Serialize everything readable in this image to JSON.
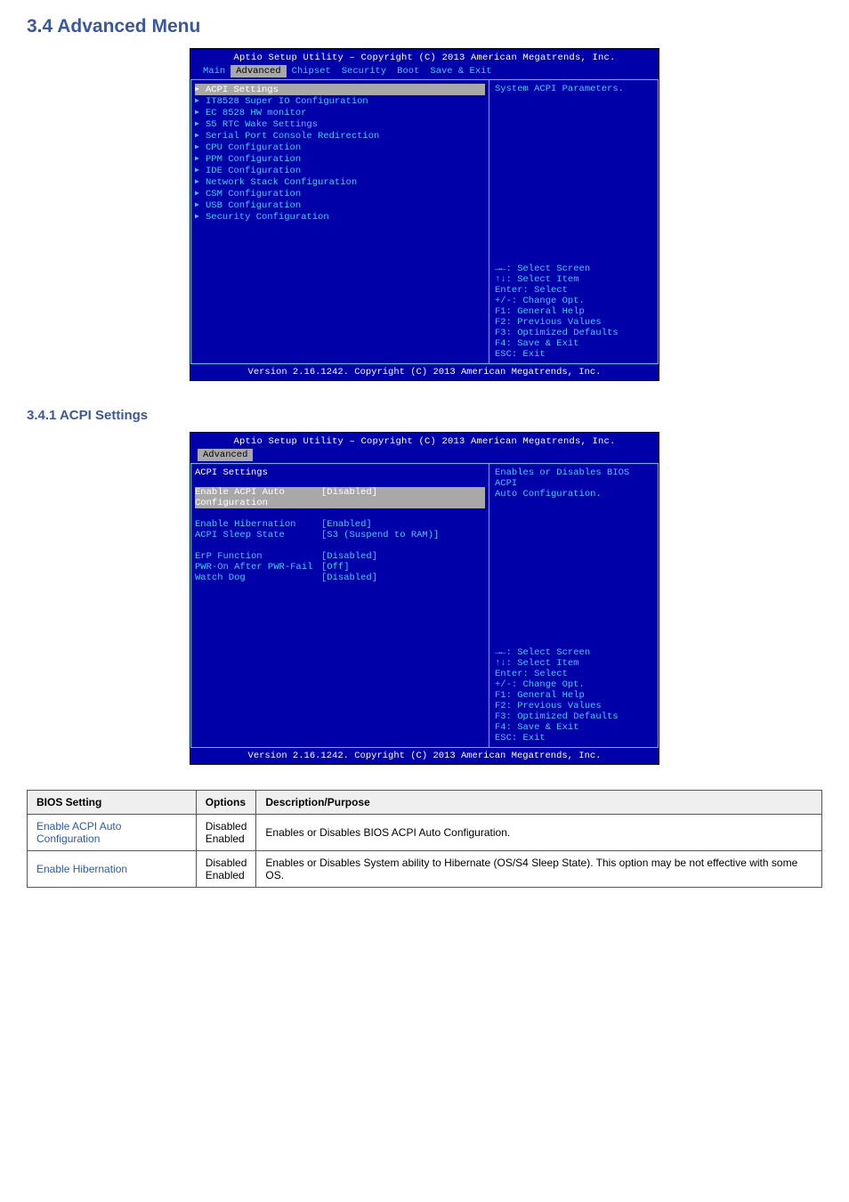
{
  "page": {
    "title": "3.4 Advanced Menu",
    "sub_title": "3.4.1 ACPI Settings"
  },
  "bios_header": "Aptio Setup Utility – Copyright (C) 2013 American Megatrends, Inc.",
  "bios_footer": "Version 2.16.1242. Copyright (C) 2013 American Megatrends, Inc.",
  "tabs": [
    "Main",
    "Advanced",
    "Chipset",
    "Security",
    "Boot",
    "Save & Exit"
  ],
  "screen1": {
    "menu": [
      "ACPI Settings",
      "IT8528 Super IO Configuration",
      "EC 8528 HW monitor",
      "S5 RTC Wake Settings",
      "Serial Port Console Redirection",
      "CPU Configuration",
      "PPM Configuration",
      "IDE Configuration",
      "Network Stack Configuration",
      "CSM Configuration",
      "USB Configuration",
      "Security Configuration"
    ],
    "help": "System ACPI Parameters."
  },
  "screen2": {
    "heading": "ACPI Settings",
    "rows": [
      {
        "label": "Enable ACPI Auto Configuration",
        "value": "[Disabled]",
        "sel": true
      },
      {
        "label": "Enable Hibernation",
        "value": "[Enabled]"
      },
      {
        "label": "ACPI Sleep State",
        "value": "[S3 (Suspend to RAM)]"
      },
      {
        "label": "ErP Function",
        "value": "[Disabled]"
      },
      {
        "label": "PWR-On After PWR-Fail",
        "value": "[Off]"
      },
      {
        "label": "Watch Dog",
        "value": "[Disabled]"
      }
    ],
    "help1": "Enables or Disables BIOS ACPI",
    "help2": "Auto Configuration."
  },
  "keyhelp": [
    "→←: Select Screen",
    "↑↓: Select Item",
    "Enter: Select",
    "+/-: Change Opt.",
    "F1: General Help",
    "F2: Previous Values",
    "F3: Optimized Defaults",
    "F4: Save & Exit",
    "ESC: Exit"
  ],
  "table": {
    "headers": [
      "BIOS Setting",
      "Options",
      "Description/Purpose"
    ],
    "rows": [
      {
        "c1": "Enable ACPI Auto Configuration",
        "c2": "Disabled\nEnabled",
        "c3": "Enables or Disables BIOS ACPI Auto Configuration."
      },
      {
        "c1": "Enable Hibernation",
        "c2": "Disabled\nEnabled",
        "c3": "Enables or Disables System ability to Hibernate (OS/S4 Sleep State). This option may be not effective with some OS."
      }
    ]
  }
}
